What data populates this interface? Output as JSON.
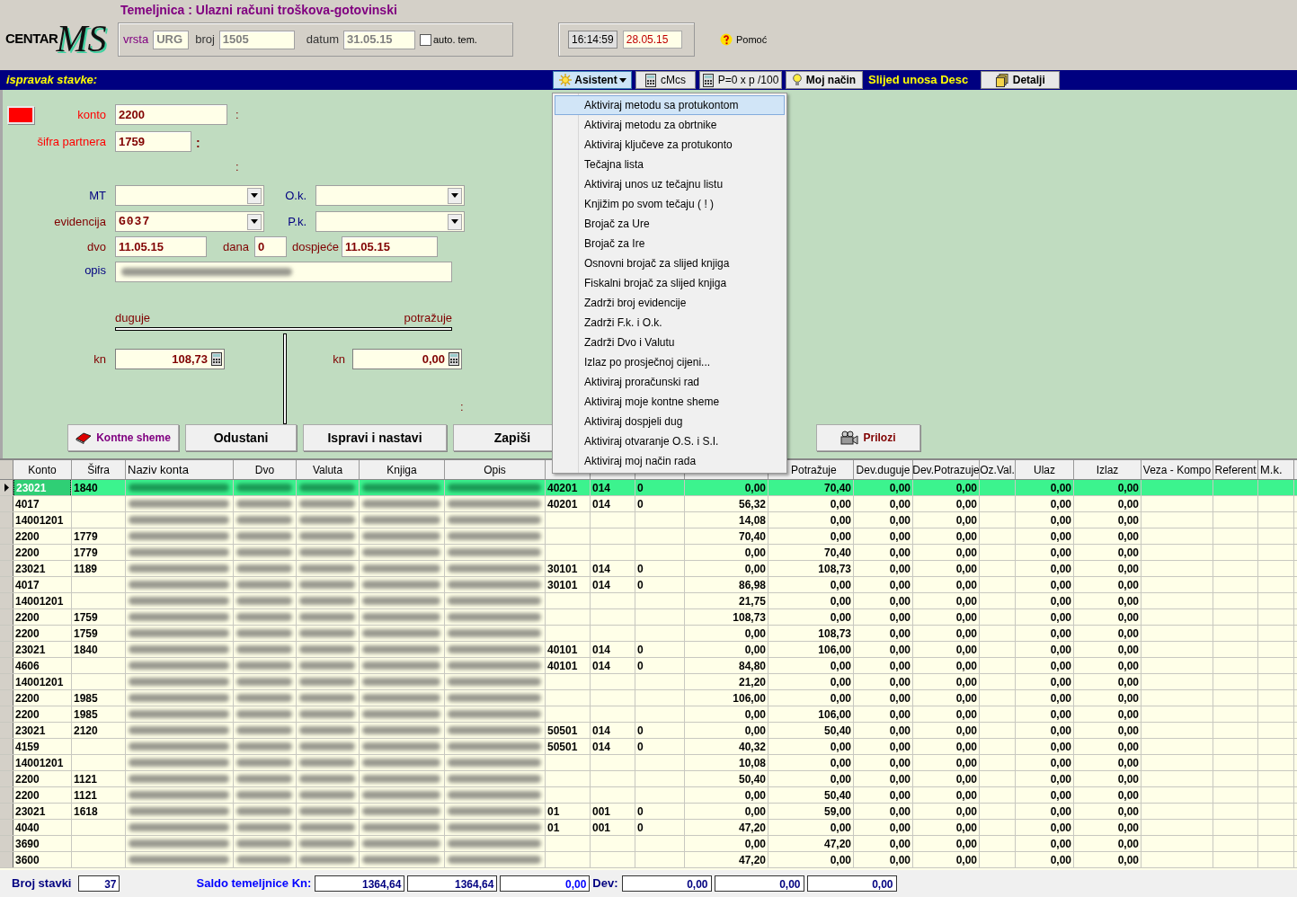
{
  "brand": {
    "text": "CENTAR",
    "mark": "MS"
  },
  "title": "Temeljnica : Ulazni računi troškova-gotovinski",
  "document": {
    "vrsta": {
      "label": "vrsta",
      "value": "URG"
    },
    "broj": {
      "label": "broj",
      "value": "1505"
    },
    "datum": {
      "label": "datum",
      "value": "31.05.15"
    },
    "auto_tem": {
      "label": "auto. tem.",
      "checked": false
    }
  },
  "clock": {
    "time": "16:14:59",
    "date": "28.05.15"
  },
  "help": {
    "label": "Pomoć"
  },
  "mode_label": "ispravak stavke:",
  "toolbar": [
    {
      "kind": "menu",
      "label": "Asistent",
      "expanded": true
    },
    {
      "kind": "button",
      "label": "cMcs"
    },
    {
      "kind": "button",
      "label": "P=0 x p /100"
    },
    {
      "kind": "button",
      "label": "Moj način"
    },
    {
      "kind": "label",
      "label": "Slijed unosa Desc"
    },
    {
      "kind": "button",
      "label": "Detalji"
    }
  ],
  "form": {
    "status_swatch": {
      "color": "#ff0000"
    },
    "konto": {
      "label": "konto",
      "value": "2200",
      "note": ":"
    },
    "sifra_partnera": {
      "label": "šifra partnera",
      "value": "1759",
      "note": ":"
    },
    "note": ":",
    "mt": {
      "label": "MT"
    },
    "ok": {
      "label": "O.k."
    },
    "evidencija": {
      "label": "evidencija",
      "value": "G037"
    },
    "pk": {
      "label": "P.k."
    },
    "dvo": {
      "label": "dvo",
      "value": "11.05.15"
    },
    "dana": {
      "label": "dana",
      "value": "0"
    },
    "dospjece": {
      "label": "dospjeće",
      "value": "11.05.15"
    },
    "opis": {
      "label": "opis",
      "redacted": true
    },
    "t_account": {
      "debit_label": "duguje",
      "credit_label": "potražuje",
      "debit": {
        "currency": "kn",
        "value": "108,73"
      },
      "credit": {
        "currency": "kn",
        "value": "0,00"
      },
      "note": ":"
    }
  },
  "buttons": [
    {
      "label": "Kontne sheme"
    },
    {
      "label": "Odustani"
    },
    {
      "label": "Ispravi i nastavi"
    },
    {
      "label": "Zapiši"
    },
    {
      "label": "Prilozi"
    }
  ],
  "menu": {
    "items": [
      {
        "label": "Aktiviraj metodu sa protukontom",
        "selected": true
      },
      {
        "label": "Aktiviraj metodu za obrtnike",
        "selected": false
      },
      {
        "label": "Aktiviraj ključeve za protukonto",
        "selected": false
      },
      {
        "label": "Tečajna lista",
        "selected": false
      },
      {
        "label": "Aktiviraj unos uz tečajnu listu",
        "selected": false
      },
      {
        "label": "Knjižim po svom tečaju ( ! )",
        "selected": false
      },
      {
        "label": "Brojač za Ure",
        "selected": false
      },
      {
        "label": "Brojač za Ire",
        "selected": false
      },
      {
        "label": "Osnovni brojač za slijed knjiga",
        "selected": false
      },
      {
        "label": "Fiskalni brojač za slijed knjiga",
        "selected": false
      },
      {
        "label": "Zadrži broj evidencije",
        "selected": false
      },
      {
        "label": "Zadrži F.k. i O.k.",
        "selected": false
      },
      {
        "label": "Zadrži Dvo i Valutu",
        "selected": false
      },
      {
        "label": "Izlaz po prosječnoj cijeni...",
        "selected": false
      },
      {
        "label": "Aktiviraj proračunski rad",
        "selected": false
      },
      {
        "label": "Aktiviraj moje kontne sheme",
        "selected": false
      },
      {
        "label": "Aktiviraj dospjeli dug",
        "selected": false
      },
      {
        "label": "Aktiviraj otvaranje O.S. i S.I.",
        "selected": false
      },
      {
        "label": "Aktiviraj moj način rada",
        "selected": false
      }
    ]
  },
  "table": {
    "columns": [
      {
        "label": "Konto"
      },
      {
        "label": "Šifra"
      },
      {
        "label": "Naziv konta"
      },
      {
        "label": "Dvo"
      },
      {
        "label": "Valuta"
      },
      {
        "label": "Knjiga"
      },
      {
        "label": "Opis"
      },
      {},
      {},
      {},
      {},
      {
        "label": "Potražuje"
      },
      {
        "label": "Dev.duguje"
      },
      {
        "label": "Dev.Potrazuje"
      },
      {
        "label": "Oz.Val."
      },
      {
        "label": "Ulaz"
      },
      {
        "label": "Izlaz"
      },
      {
        "label": "Veza - Kompo"
      },
      {
        "label": "Referent"
      },
      {
        "label": "M.k."
      }
    ],
    "rows": [
      {
        "selected": true,
        "redacted": true,
        "konto": "23021",
        "sifra": "1840",
        "column_8": "40201",
        "column_9": "014",
        "column_10": "0",
        "column_11": "0,00",
        "potrazuje": "70,40",
        "dev_duguje": "0,00",
        "dev_potrazuje": "0,00",
        "ulaz": "0,00",
        "izlaz": "0,00"
      },
      {
        "selected": false,
        "redacted": true,
        "konto": "4017",
        "column_8": "40201",
        "column_9": "014",
        "column_10": "0",
        "column_11": "56,32",
        "potrazuje": "0,00",
        "dev_duguje": "0,00",
        "dev_potrazuje": "0,00",
        "ulaz": "0,00",
        "izlaz": "0,00"
      },
      {
        "selected": false,
        "redacted": true,
        "konto": "14001201",
        "column_11": "14,08",
        "potrazuje": "0,00",
        "dev_duguje": "0,00",
        "dev_potrazuje": "0,00",
        "ulaz": "0,00",
        "izlaz": "0,00"
      },
      {
        "selected": false,
        "redacted": true,
        "konto": "2200",
        "sifra": "1779",
        "column_11": "70,40",
        "potrazuje": "0,00",
        "dev_duguje": "0,00",
        "dev_potrazuje": "0,00",
        "ulaz": "0,00",
        "izlaz": "0,00"
      },
      {
        "selected": false,
        "redacted": true,
        "konto": "2200",
        "sifra": "1779",
        "column_11": "0,00",
        "potrazuje": "70,40",
        "dev_duguje": "0,00",
        "dev_potrazuje": "0,00",
        "ulaz": "0,00",
        "izlaz": "0,00"
      },
      {
        "selected": false,
        "redacted": true,
        "konto": "23021",
        "sifra": "1189",
        "column_8": "30101",
        "column_9": "014",
        "column_10": "0",
        "column_11": "0,00",
        "potrazuje": "108,73",
        "dev_duguje": "0,00",
        "dev_potrazuje": "0,00",
        "ulaz": "0,00",
        "izlaz": "0,00"
      },
      {
        "selected": false,
        "redacted": true,
        "konto": "4017",
        "column_8": "30101",
        "column_9": "014",
        "column_10": "0",
        "column_11": "86,98",
        "potrazuje": "0,00",
        "dev_duguje": "0,00",
        "dev_potrazuje": "0,00",
        "ulaz": "0,00",
        "izlaz": "0,00"
      },
      {
        "selected": false,
        "redacted": true,
        "konto": "14001201",
        "column_11": "21,75",
        "potrazuje": "0,00",
        "dev_duguje": "0,00",
        "dev_potrazuje": "0,00",
        "ulaz": "0,00",
        "izlaz": "0,00"
      },
      {
        "selected": false,
        "redacted": true,
        "konto": "2200",
        "sifra": "1759",
        "column_11": "108,73",
        "potrazuje": "0,00",
        "dev_duguje": "0,00",
        "dev_potrazuje": "0,00",
        "ulaz": "0,00",
        "izlaz": "0,00"
      },
      {
        "selected": false,
        "redacted": true,
        "konto": "2200",
        "sifra": "1759",
        "column_11": "0,00",
        "potrazuje": "108,73",
        "dev_duguje": "0,00",
        "dev_potrazuje": "0,00",
        "ulaz": "0,00",
        "izlaz": "0,00"
      },
      {
        "selected": false,
        "redacted": true,
        "konto": "23021",
        "sifra": "1840",
        "column_8": "40101",
        "column_9": "014",
        "column_10": "0",
        "column_11": "0,00",
        "potrazuje": "106,00",
        "dev_duguje": "0,00",
        "dev_potrazuje": "0,00",
        "ulaz": "0,00",
        "izlaz": "0,00"
      },
      {
        "selected": false,
        "redacted": true,
        "konto": "4606",
        "column_8": "40101",
        "column_9": "014",
        "column_10": "0",
        "column_11": "84,80",
        "potrazuje": "0,00",
        "dev_duguje": "0,00",
        "dev_potrazuje": "0,00",
        "ulaz": "0,00",
        "izlaz": "0,00"
      },
      {
        "selected": false,
        "redacted": true,
        "konto": "14001201",
        "column_11": "21,20",
        "potrazuje": "0,00",
        "dev_duguje": "0,00",
        "dev_potrazuje": "0,00",
        "ulaz": "0,00",
        "izlaz": "0,00"
      },
      {
        "selected": false,
        "redacted": true,
        "konto": "2200",
        "sifra": "1985",
        "column_11": "106,00",
        "potrazuje": "0,00",
        "dev_duguje": "0,00",
        "dev_potrazuje": "0,00",
        "ulaz": "0,00",
        "izlaz": "0,00"
      },
      {
        "selected": false,
        "redacted": true,
        "konto": "2200",
        "sifra": "1985",
        "column_11": "0,00",
        "potrazuje": "106,00",
        "dev_duguje": "0,00",
        "dev_potrazuje": "0,00",
        "ulaz": "0,00",
        "izlaz": "0,00"
      },
      {
        "selected": false,
        "redacted": true,
        "konto": "23021",
        "sifra": "2120",
        "column_8": "50501",
        "column_9": "014",
        "column_10": "0",
        "column_11": "0,00",
        "potrazuje": "50,40",
        "dev_duguje": "0,00",
        "dev_potrazuje": "0,00",
        "ulaz": "0,00",
        "izlaz": "0,00"
      },
      {
        "selected": false,
        "redacted": true,
        "konto": "4159",
        "column_8": "50501",
        "column_9": "014",
        "column_10": "0",
        "column_11": "40,32",
        "potrazuje": "0,00",
        "dev_duguje": "0,00",
        "dev_potrazuje": "0,00",
        "ulaz": "0,00",
        "izlaz": "0,00"
      },
      {
        "selected": false,
        "redacted": true,
        "konto": "14001201",
        "column_11": "10,08",
        "potrazuje": "0,00",
        "dev_duguje": "0,00",
        "dev_potrazuje": "0,00",
        "ulaz": "0,00",
        "izlaz": "0,00"
      },
      {
        "selected": false,
        "redacted": true,
        "konto": "2200",
        "sifra": "1121",
        "column_11": "50,40",
        "potrazuje": "0,00",
        "dev_duguje": "0,00",
        "dev_potrazuje": "0,00",
        "ulaz": "0,00",
        "izlaz": "0,00"
      },
      {
        "selected": false,
        "redacted": true,
        "konto": "2200",
        "sifra": "1121",
        "column_11": "0,00",
        "potrazuje": "50,40",
        "dev_duguje": "0,00",
        "dev_potrazuje": "0,00",
        "ulaz": "0,00",
        "izlaz": "0,00"
      },
      {
        "selected": false,
        "redacted": true,
        "konto": "23021",
        "sifra": "1618",
        "column_8": "01",
        "column_9": "001",
        "column_10": "0",
        "column_11": "0,00",
        "potrazuje": "59,00",
        "dev_duguje": "0,00",
        "dev_potrazuje": "0,00",
        "ulaz": "0,00",
        "izlaz": "0,00"
      },
      {
        "selected": false,
        "redacted": true,
        "konto": "4040",
        "column_8": "01",
        "column_9": "001",
        "column_10": "0",
        "column_11": "47,20",
        "potrazuje": "0,00",
        "dev_duguje": "0,00",
        "dev_potrazuje": "0,00",
        "ulaz": "0,00",
        "izlaz": "0,00"
      },
      {
        "selected": false,
        "redacted": true,
        "konto": "3690",
        "column_11": "0,00",
        "potrazuje": "47,20",
        "dev_duguje": "0,00",
        "dev_potrazuje": "0,00",
        "ulaz": "0,00",
        "izlaz": "0,00"
      },
      {
        "selected": false,
        "redacted": true,
        "konto": "3600",
        "column_11": "47,20",
        "potrazuje": "0,00",
        "dev_duguje": "0,00",
        "dev_potrazuje": "0,00",
        "ulaz": "0,00",
        "izlaz": "0,00"
      }
    ]
  },
  "footer": {
    "count_label": "Broj stavki",
    "count": "37",
    "saldo_label": "Saldo temeljnice Kn:",
    "saldo": [
      "1364,64",
      "1364,64",
      "0,00"
    ],
    "dev_label": "Dev:",
    "dev": [
      "0,00",
      "0,00",
      "0,00"
    ]
  }
}
